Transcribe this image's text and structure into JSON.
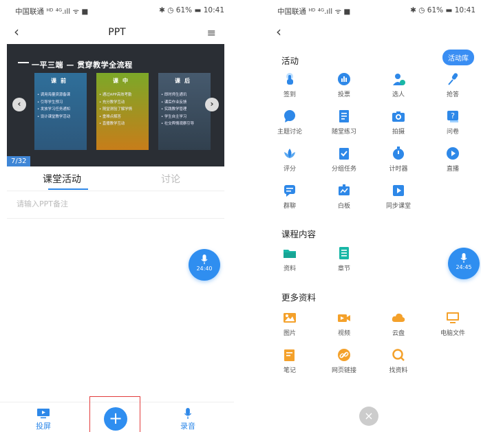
{
  "left": {
    "status": {
      "carrier": "中国联通 ᴴᴰ ⁴ᴳ.ıll ᯤ ■",
      "system": "✱ ◷ 61% ▬ 10:41"
    },
    "nav": {
      "back": "‹",
      "title": "PPT",
      "menu": "≡"
    },
    "slide": {
      "title": "一平三端 — 贯穿教学全流程",
      "page": "7/32",
      "columns": [
        {
          "heading": "课前",
          "items": [
            "• 调用海量资源备课",
            "• 引导学生预习",
            "• 发放学习任务通知",
            "• 设计课堂教学活动"
          ]
        },
        {
          "heading": "课中",
          "items": [
            "• 通过APP高效考勤",
            "• 充分教学互动",
            "• 随堂测验了解学情",
            "• 重难点解答",
            "• 直播教学互动"
          ]
        },
        {
          "heading": "课后",
          "items": [
            "• 即时师生通讯",
            "• 课后作业反馈",
            "• 实践教学管理",
            "• 学生自主学习",
            "• 社交舆情观察引导"
          ]
        }
      ]
    },
    "tabs": {
      "activity": "课堂活动",
      "discussion": "讨论"
    },
    "notes_placeholder": "请输入PPT备注",
    "mic_timer": "24:40",
    "bottom": {
      "cast": "投屏",
      "record": "录音",
      "plus": "+"
    }
  },
  "right": {
    "status": {
      "carrier": "中国联通 ᴴᴰ ⁴ᴳ.ıll ᯤ ■",
      "system": "✱ ◷ 61% ▬ 10:41"
    },
    "nav": {
      "back": "‹"
    },
    "sections": {
      "activity": "活动",
      "content": "课程内容",
      "more": "更多资料"
    },
    "library_button": "活动库",
    "activities": [
      {
        "label": "签到",
        "icon": "hand-tap-icon"
      },
      {
        "label": "投票",
        "icon": "bar-chart-icon"
      },
      {
        "label": "选人",
        "icon": "person-check-icon"
      },
      {
        "label": "抢答",
        "icon": "microphone-icon"
      },
      {
        "label": "主题讨论",
        "icon": "chat-bubble-icon"
      },
      {
        "label": "随堂练习",
        "icon": "document-list-icon"
      },
      {
        "label": "拍摄",
        "icon": "camera-icon"
      },
      {
        "label": "问卷",
        "icon": "question-icon"
      },
      {
        "label": "评分",
        "icon": "lotus-icon"
      },
      {
        "label": "分组任务",
        "icon": "task-check-icon"
      },
      {
        "label": "计时器",
        "icon": "stopwatch-icon"
      },
      {
        "label": "直播",
        "icon": "play-circle-icon"
      },
      {
        "label": "群聊",
        "icon": "message-icon"
      },
      {
        "label": "白板",
        "icon": "whiteboard-icon"
      },
      {
        "label": "同步课堂",
        "icon": "play-square-icon"
      }
    ],
    "content_items": [
      {
        "label": "资料",
        "icon": "folder-icon"
      },
      {
        "label": "章节",
        "icon": "chapter-list-icon"
      }
    ],
    "more_items": [
      {
        "label": "图片",
        "icon": "image-icon"
      },
      {
        "label": "视频",
        "icon": "video-icon"
      },
      {
        "label": "云盘",
        "icon": "cloud-icon"
      },
      {
        "label": "电脑文件",
        "icon": "monitor-icon"
      },
      {
        "label": "笔记",
        "icon": "note-icon"
      },
      {
        "label": "网页链接",
        "icon": "link-icon"
      },
      {
        "label": "找资料",
        "icon": "search-icon"
      }
    ],
    "mic_timer": "24:45",
    "close": "×"
  },
  "colors": {
    "accent": "#2e88e8",
    "orange": "#f4a12b",
    "teal": "#19b7a6",
    "highlight_frame": "#e23b3b"
  }
}
